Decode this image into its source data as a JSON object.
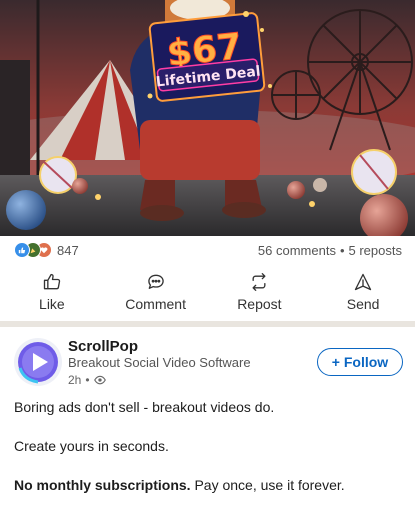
{
  "hero": {
    "price": "$67",
    "deal": "Lifetime Deal"
  },
  "stats": {
    "reaction_count": "847",
    "comments": "56 comments",
    "separator": "•",
    "reposts": "5 reposts"
  },
  "actions": [
    {
      "label": "Like",
      "icon": "thumbs-up-icon"
    },
    {
      "label": "Comment",
      "icon": "comment-icon"
    },
    {
      "label": "Repost",
      "icon": "repost-icon"
    },
    {
      "label": "Send",
      "icon": "send-icon"
    }
  ],
  "post": {
    "author": "ScrollPop",
    "tagline": "Breakout Social Video Software",
    "time": "2h",
    "meta_separator": "•",
    "follow_label": "+ Follow",
    "line1": "Boring ads don't sell - breakout videos do.",
    "line2": "Create yours in seconds.",
    "line3_bold": "No monthly subscriptions.",
    "line3_rest": " Pay once, use it forever."
  },
  "colors": {
    "accent": "#0a66c2",
    "divider": "#e9e5df",
    "sky": "#c9322b"
  }
}
